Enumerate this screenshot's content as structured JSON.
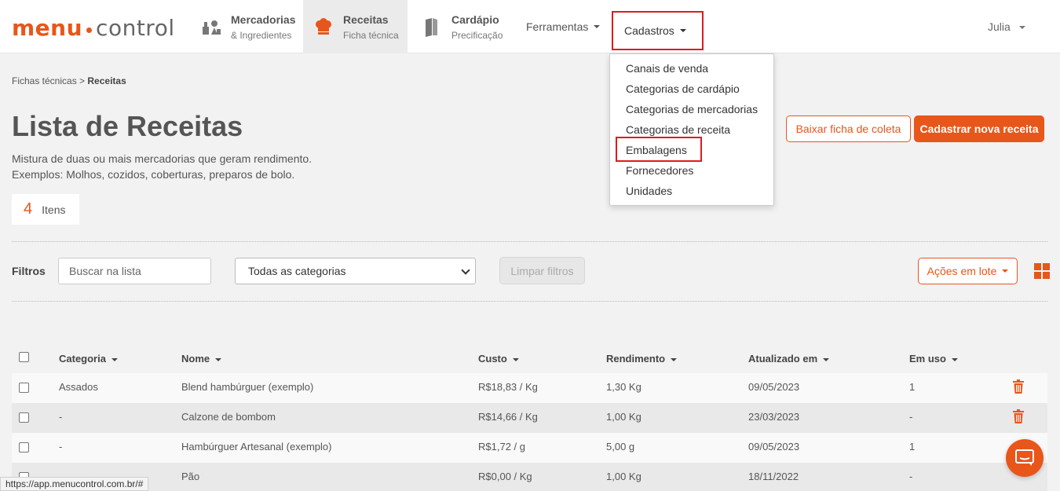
{
  "brand": {
    "part1": "menu",
    "part2": "control"
  },
  "nav": {
    "mercadorias": {
      "title": "Mercadorias",
      "subtitle": "& Ingredientes"
    },
    "receitas": {
      "title": "Receitas",
      "subtitle": "Ficha técnica"
    },
    "cardapio": {
      "title": "Cardápio",
      "subtitle": "Precificação"
    },
    "ferramentas": "Ferramentas",
    "cadastros": "Cadastros",
    "user": "Julia"
  },
  "dropdown": {
    "items": [
      "Canais de venda",
      "Categorias de cardápio",
      "Categorias de mercadorias",
      "Categorias de receita",
      "Embalagens",
      "Fornecedores",
      "Unidades"
    ]
  },
  "breadcrumb": {
    "parent": "Fichas técnicas",
    "sep": " > ",
    "current": "Receitas"
  },
  "page": {
    "title": "Lista de Receitas",
    "desc1": "Mistura de duas ou mais mercadorias que geram rendimento.",
    "desc2": "Exemplos: Molhos, cozidos, coberturas, preparos de bolo.",
    "count": "4",
    "count_label": "Itens"
  },
  "actions": {
    "baixar": "Baixar ficha de coleta",
    "cadastrar": "Cadastrar nova receita"
  },
  "filters": {
    "label": "Filtros",
    "search_placeholder": "Buscar na lista",
    "category_selected": "Todas as categorias",
    "clear": "Limpar filtros",
    "bulk": "Ações em lote"
  },
  "table": {
    "headers": {
      "categoria": "Categoria",
      "nome": "Nome",
      "custo": "Custo",
      "rendimento": "Rendimento",
      "atualizado": "Atualizado em",
      "emuso": "Em uso"
    },
    "rows": [
      {
        "categoria": "Assados",
        "nome": "Blend hambúrguer (exemplo)",
        "custo": "R$18,83 / Kg",
        "rendimento": "1,30 Kg",
        "atualizado": "09/05/2023",
        "emuso": "1"
      },
      {
        "categoria": "-",
        "nome": "Calzone de bombom",
        "custo": "R$14,66 / Kg",
        "rendimento": "1,00 Kg",
        "atualizado": "23/03/2023",
        "emuso": "-"
      },
      {
        "categoria": "-",
        "nome": "Hambúrguer Artesanal (exemplo)",
        "custo": "R$1,72 / g",
        "rendimento": "5,00 g",
        "atualizado": "09/05/2023",
        "emuso": "1"
      },
      {
        "categoria": "",
        "nome": "Pão",
        "custo": "R$0,00 / Kg",
        "rendimento": "1,00 Kg",
        "atualizado": "18/11/2022",
        "emuso": "-"
      }
    ]
  },
  "status_url": "https://app.menucontrol.com.br/#",
  "colors": {
    "accent": "#e8561a",
    "highlight": "#e01b1b"
  }
}
